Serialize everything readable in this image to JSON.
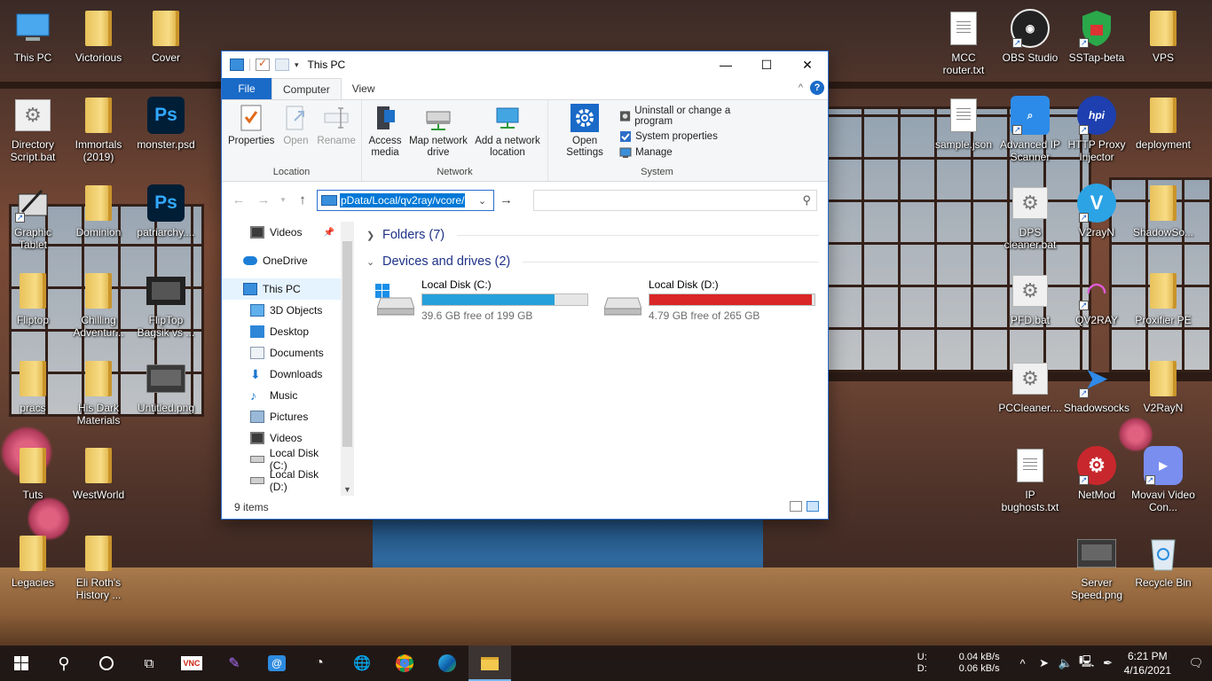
{
  "desktop": {
    "left_icons": [
      {
        "label": "This PC",
        "type": "pc"
      },
      {
        "label": "Victorious",
        "type": "folder"
      },
      {
        "label": "Cover",
        "type": "folder"
      },
      {
        "label": "Directory Script.bat",
        "type": "gear"
      },
      {
        "label": "Immortals (2019)",
        "type": "folder"
      },
      {
        "label": "monster.psd",
        "type": "ps"
      },
      {
        "label": "Graphic Tablet",
        "type": "tablet"
      },
      {
        "label": "Dominion",
        "type": "folder"
      },
      {
        "label": "patriarchy....",
        "type": "ps"
      },
      {
        "label": "Fliptop",
        "type": "folder"
      },
      {
        "label": "Chilling Adventur...",
        "type": "folder"
      },
      {
        "label": "FlipTop Bagsik vs ...",
        "type": "video"
      },
      {
        "label": "pracs",
        "type": "folder"
      },
      {
        "label": "His Dark Materials",
        "type": "folder"
      },
      {
        "label": "Untitled.png",
        "type": "image"
      },
      {
        "label": "Tuts",
        "type": "folder"
      },
      {
        "label": "WestWorld",
        "type": "folder"
      },
      {
        "label": "Legacies",
        "type": "folder"
      },
      {
        "label": "Eli Roth's History ...",
        "type": "folder"
      }
    ],
    "right_icons": [
      {
        "label": "MCC router.txt",
        "type": "doc"
      },
      {
        "label": "OBS Studio",
        "type": "obs"
      },
      {
        "label": "SSTap-beta",
        "type": "shield"
      },
      {
        "label": "VPS",
        "type": "folder"
      },
      {
        "label": "sample.json",
        "type": "doc"
      },
      {
        "label": "Advanced IP Scanner",
        "type": "ipscan"
      },
      {
        "label": "HTTP Proxy Injector",
        "type": "hpi"
      },
      {
        "label": "deployment",
        "type": "folder"
      },
      {
        "label": "DPS cleaner.bat",
        "type": "gear"
      },
      {
        "label": "V2rayN",
        "type": "v2"
      },
      {
        "label": "ShadowSo...",
        "type": "folder"
      },
      {
        "label": "PFD.bat",
        "type": "gear"
      },
      {
        "label": "QV2RAY",
        "type": "qv2"
      },
      {
        "label": "Proxifier PE",
        "type": "folder"
      },
      {
        "label": "PCCleaner....",
        "type": "gear"
      },
      {
        "label": "Shadowsocks",
        "type": "plane"
      },
      {
        "label": "V2RayN",
        "type": "folder"
      },
      {
        "label": "IP bughosts.txt",
        "type": "doc"
      },
      {
        "label": "NetMod",
        "type": "netmod"
      },
      {
        "label": "Movavi Video Con...",
        "type": "movavi"
      },
      {
        "label": "Server Speed.png",
        "type": "image"
      },
      {
        "label": "Recycle Bin",
        "type": "bin"
      }
    ]
  },
  "explorer": {
    "title": "This PC",
    "tabs": {
      "file": "File",
      "computer": "Computer",
      "view": "View"
    },
    "help": "?",
    "ribbon": {
      "location": {
        "name": "Location",
        "properties": "Properties",
        "open": "Open",
        "rename": "Rename"
      },
      "network": {
        "name": "Network",
        "access_media": "Access media",
        "map_drive": "Map network drive",
        "add_location": "Add a network location"
      },
      "system": {
        "name": "System",
        "open_settings": "Open Settings",
        "uninstall": "Uninstall or change a program",
        "system_properties": "System properties",
        "manage": "Manage"
      }
    },
    "address": "pData/Local/qv2ray/vcore/",
    "search_placeholder": "",
    "nav_items": [
      {
        "label": "Videos",
        "icon": "video-icon",
        "indent": 1,
        "pinned": true
      },
      {
        "label": "OneDrive",
        "icon": "cloud-icon",
        "indent": 0
      },
      {
        "label": "This PC",
        "icon": "pc-icon",
        "indent": 0,
        "selected": true
      },
      {
        "label": "3D Objects",
        "icon": "cube-icon",
        "indent": 1
      },
      {
        "label": "Desktop",
        "icon": "desktop-icon",
        "indent": 1
      },
      {
        "label": "Documents",
        "icon": "documents-icon",
        "indent": 1
      },
      {
        "label": "Downloads",
        "icon": "download-icon",
        "indent": 1
      },
      {
        "label": "Music",
        "icon": "music-icon",
        "indent": 1
      },
      {
        "label": "Pictures",
        "icon": "pictures-icon",
        "indent": 1
      },
      {
        "label": "Videos",
        "icon": "video-icon",
        "indent": 1
      },
      {
        "label": "Local Disk (C:)",
        "icon": "drive-icon",
        "indent": 1
      },
      {
        "label": "Local Disk (D:)",
        "icon": "drive-icon",
        "indent": 1
      }
    ],
    "folders_section": "Folders (7)",
    "devices_section": "Devices and drives (2)",
    "drives": [
      {
        "name": "Local Disk (C:)",
        "free": "39.6 GB free of 199 GB",
        "used_fraction": 0.8,
        "color": "#26a0da",
        "windows": true
      },
      {
        "name": "Local Disk (D:)",
        "free": "4.79 GB free of 265 GB",
        "used_fraction": 0.982,
        "color": "#da2626",
        "windows": false
      }
    ],
    "status": "9 items"
  },
  "taskbar": {
    "net_labels": [
      "U:",
      "D:"
    ],
    "net_values": [
      "0.04 kB/s",
      "0.06 kB/s"
    ],
    "time": "6:21 PM",
    "date": "4/16/2021"
  }
}
